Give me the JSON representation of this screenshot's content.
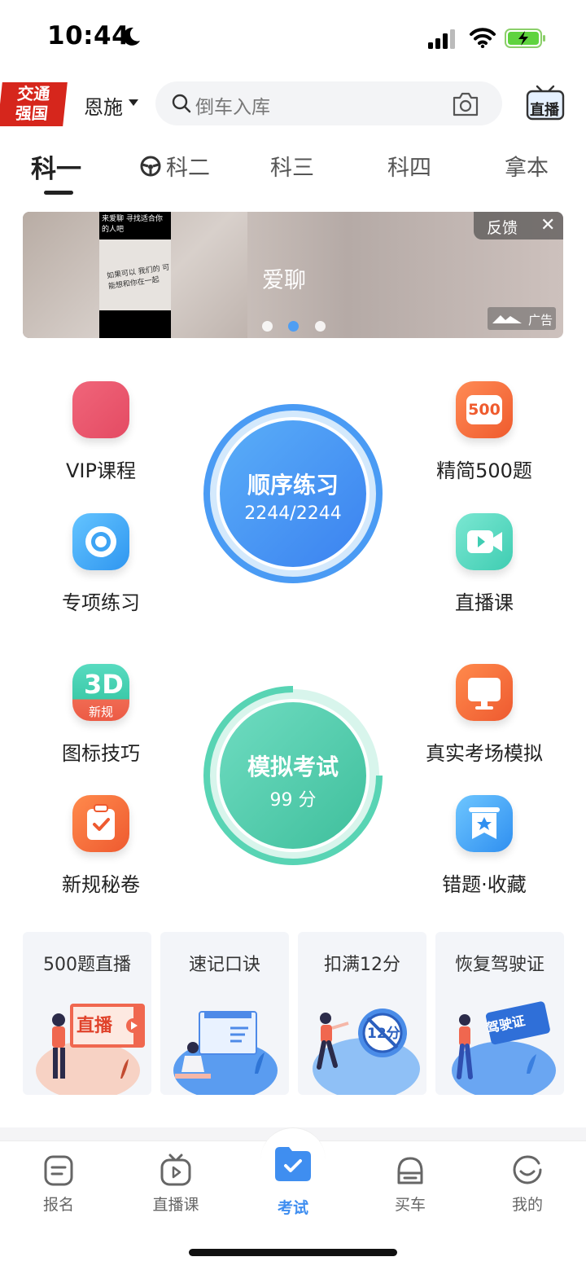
{
  "status_bar": {
    "time": "10:44"
  },
  "header": {
    "logo_text_line1": "交通",
    "logo_text_line2": "强国",
    "city": "恩施",
    "search_placeholder": "倒车入库",
    "live_label": "直播"
  },
  "tabs": [
    {
      "label": "科一",
      "active": true
    },
    {
      "label": "科二",
      "active": false
    },
    {
      "label": "科三",
      "active": false
    },
    {
      "label": "科四",
      "active": false
    },
    {
      "label": "拿本",
      "active": false
    }
  ],
  "banner": {
    "title": "爱聊",
    "inner_top_text": "来爱聊 寻找适合你的人吧",
    "inner_note": "如果可以 我们的 可能想和你在一起",
    "feedback_label": "反馈",
    "ad_label": "广告",
    "active_dot": 2,
    "dot_count": 3
  },
  "features": {
    "vip": "VIP课程",
    "special": "专项练习",
    "jingjian": "精简500题",
    "jingjian_badge": "500",
    "live_course": "直播课",
    "sign_tips": "图标技巧",
    "sign_badge": "新规",
    "new_rules": "新规秘卷",
    "real_exam": "真实考场模拟",
    "wrong_fav": "错题·收藏"
  },
  "practice": {
    "title": "顺序练习",
    "progress": "2244/2244",
    "fraction": 1.0
  },
  "exam": {
    "title": "模拟考试",
    "score": "99 分"
  },
  "cards": [
    {
      "title": "500题直播",
      "art_label": "直播"
    },
    {
      "title": "速记口诀"
    },
    {
      "title": "扣满12分",
      "art_label": "12分"
    },
    {
      "title": "恢复驾驶证",
      "art_label": "驾驶证"
    }
  ],
  "bottom_nav": [
    {
      "label": "报名",
      "active": false
    },
    {
      "label": "直播课",
      "active": false
    },
    {
      "label": "考试",
      "active": true
    },
    {
      "label": "买车",
      "active": false
    },
    {
      "label": "我的",
      "active": false
    }
  ],
  "colors": {
    "accent": "#3f8ef0",
    "exam_green": "#4fcaa8",
    "logo_red": "#d6261c"
  }
}
